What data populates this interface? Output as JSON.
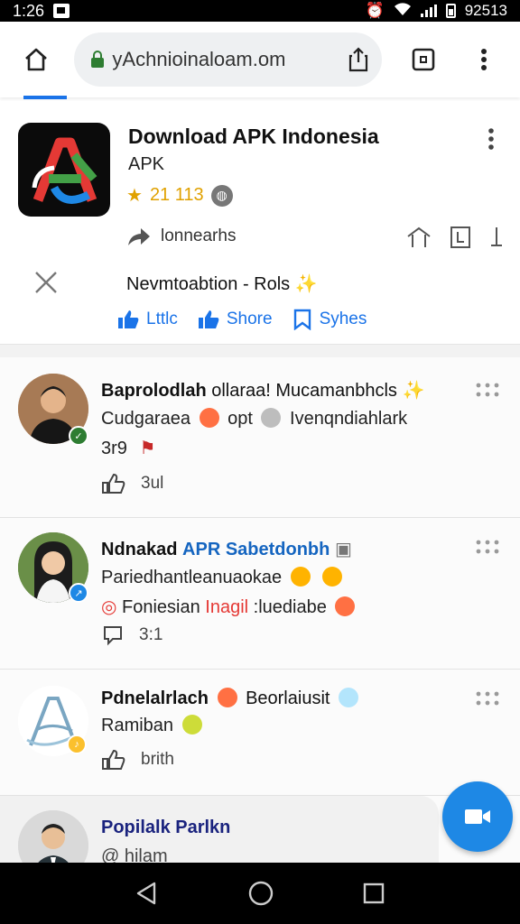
{
  "status_bar": {
    "time": "1:26",
    "right_text": "92513"
  },
  "browser": {
    "url": "yAchnioinaloam.om"
  },
  "app_card": {
    "title": "Download APK Indonesia",
    "subtitle": "APK",
    "rating": "21 113",
    "share_label": "lonnearhs",
    "notification": "Nevmtoabtion - Rols",
    "actions": [
      {
        "label": "Lttlc",
        "icon": "thumbs-up-icon"
      },
      {
        "label": "Shore",
        "icon": "thumbs-up-icon"
      },
      {
        "label": "Syhes",
        "icon": "bookmark-icon"
      }
    ]
  },
  "posts": [
    {
      "name_bold": "Baprolodlah",
      "name_rest": "ollaraa! Mucamanbhcls",
      "line1": "Cudgaraea",
      "line1b": "opt",
      "line1c": "Ivenqndiahlark",
      "line2": "3r9",
      "meta_count": "3ul"
    },
    {
      "name_bold": "Ndnakad",
      "name_blue": "APR Sabetdonbh",
      "line1": "Pariedhantleanuaokae",
      "line2a": "Foniesian",
      "line2b": "Inagil",
      "line2c": ":luediabe",
      "meta_count": "3:1"
    },
    {
      "name_bold": "Pdnelalrlach",
      "name_rest": "Beorlaiusit",
      "line1": "Ramiban",
      "meta_count": "brith"
    }
  ],
  "bottom_post": {
    "name": "Popilalk Parlkn",
    "line1": "@ hilam"
  },
  "colors": {
    "accent": "#1a73e8",
    "fab": "#1e88e5",
    "rating": "#e0a100"
  }
}
